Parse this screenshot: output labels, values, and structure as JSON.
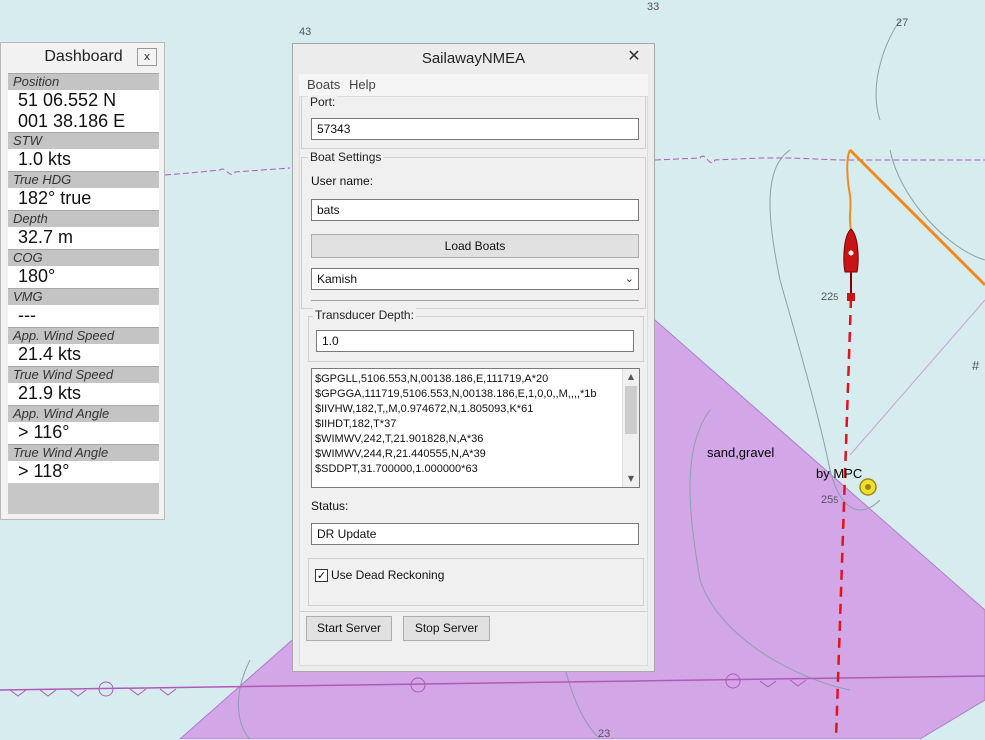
{
  "chart_labels": {
    "depth_33": "33",
    "depth_43": "43",
    "depth_27": "27",
    "depth_22": "22",
    "depth_22_sub": "5",
    "depth_25": "25",
    "depth_25_sub": "5",
    "depth_23": "23",
    "hash": "#",
    "sand_gravel": "sand,gravel",
    "by_mpc": "by MPC"
  },
  "dashboard": {
    "title": "Dashboard",
    "close_glyph": "x",
    "items": [
      {
        "label": "Position",
        "value_line1": "51 06.552 N",
        "value_line2": "001 38.186 E"
      },
      {
        "label": "STW",
        "value": "1.0 kts"
      },
      {
        "label": "True HDG",
        "value": "182° true"
      },
      {
        "label": "Depth",
        "value": "32.7 m"
      },
      {
        "label": "COG",
        "value": "180°"
      },
      {
        "label": "VMG",
        "value": "---"
      },
      {
        "label": "App. Wind Speed",
        "value": "21.4 kts"
      },
      {
        "label": "True Wind Speed",
        "value": "21.9 kts"
      },
      {
        "label": "App. Wind Angle",
        "value": ">  116°"
      },
      {
        "label": "True Wind Angle",
        "value": ">  118°"
      }
    ]
  },
  "window": {
    "title": "SailawayNMEA",
    "close_glyph": "✕",
    "menu": [
      "Boats",
      "Help"
    ],
    "port_label": "Port:",
    "port_value": "57343",
    "boat_settings_label": "Boat Settings",
    "username_label": "User name:",
    "username_value": "bats",
    "load_boats_button": "Load Boats",
    "boat_selected": "Kamish",
    "transducer_label": "Transducer Depth:",
    "transducer_value": "1.0",
    "log_lines": [
      "$GPGLL,5106.553,N,00138.186,E,111719,A*20",
      "$GPGGA,111719,5106.553,N,00138.186,E,1,0,0,,M,,,,*1b",
      "$IIVHW,182,T,,M,0.974672,N,1.805093,K*61",
      "$IIHDT,182,T*37",
      "$WIMWV,242,T,21.901828,N,A*36",
      "$WIMWV,244,R,21.440555,N,A*39",
      "$SDDPT,31.700000,1.000000*63"
    ],
    "status_label": "Status:",
    "status_value": "DR Update",
    "dead_reckoning_label": "Use Dead Reckoning",
    "dead_reckoning_checked": true,
    "start_server_button": "Start Server",
    "stop_server_button": "Stop Server"
  },
  "colors": {
    "sea": "#d6ecef",
    "zone": "#d3a6e8",
    "route": "#f08c1e",
    "track": "#e0141e",
    "boat": "#c81414"
  }
}
